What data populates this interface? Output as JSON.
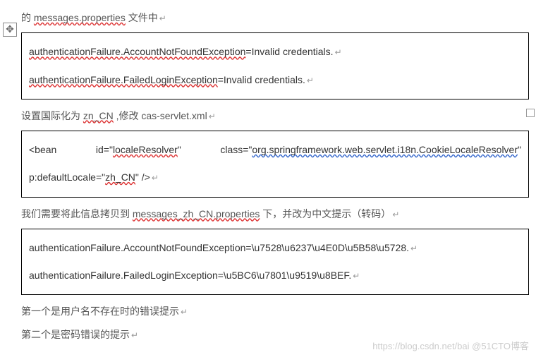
{
  "para_top": {
    "prefix": "的 ",
    "file": "messages.properties",
    "suffix": " 文件中"
  },
  "box1": {
    "l1_key": "authenticationFailure.AccountNotFoundException",
    "l1_val": "=Invalid credentials.",
    "l2_key": "authenticationFailure.FailedLoginException",
    "l2_val": "=Invalid credentials."
  },
  "para_i18n": {
    "t1": "设置国际化为 ",
    "locale": "zn_CN",
    "t2": "    ,修改 cas-servlet.xml"
  },
  "box2": {
    "t0": "<bean   id=\"",
    "id": "localeResolver",
    "t1": "\"    class=\"",
    "cls": "org.springframework.web.servlet.i18n.CookieLocaleResolver",
    "t2": "\"",
    "l2a": "p:defaultLocale=\"",
    "l2loc": "zh_CN",
    "l2b": "\" />"
  },
  "para_copy": {
    "t1": "我们需要将此信息拷贝到 ",
    "file": "messages_zh_CN.properties",
    "t2": " 下，并改为中文提示（转码）"
  },
  "box3": {
    "l1": "authenticationFailure.AccountNotFoundException=\\u7528\\u6237\\u4E0D\\u5B58\\u5728.",
    "l2": "authenticationFailure.FailedLoginException=\\u5BC6\\u7801\\u9519\\u8BEF."
  },
  "para_foot1": "第一个是用户名不存在时的错误提示",
  "para_foot2": "第二个是密码错误的提示",
  "watermark": "https://blog.csdn.net/bai  @51CTO博客",
  "move_glyph": "✥"
}
